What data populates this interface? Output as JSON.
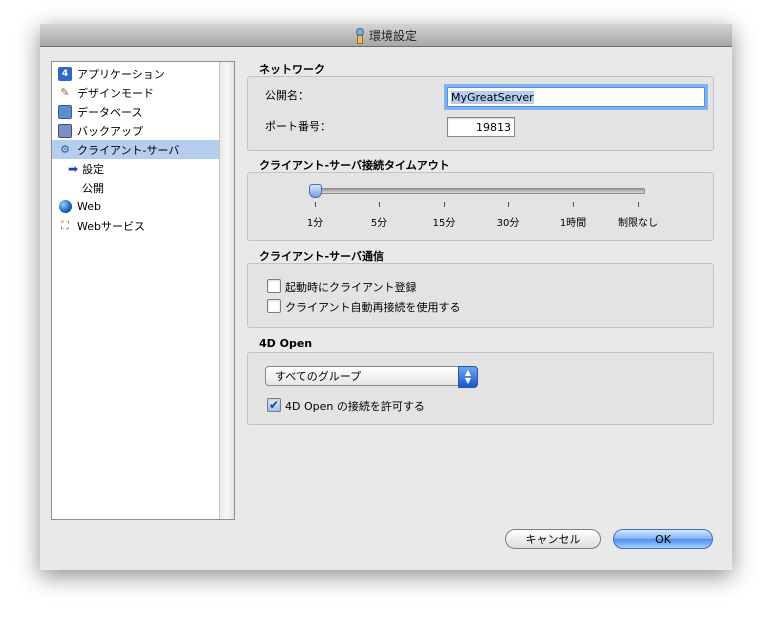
{
  "window": {
    "title": "環境設定"
  },
  "sidebar": {
    "items": [
      {
        "label": "アプリケーション",
        "icon": "application-icon"
      },
      {
        "label": "デザインモード",
        "icon": "design-mode-icon"
      },
      {
        "label": "データベース",
        "icon": "database-icon"
      },
      {
        "label": "バックアップ",
        "icon": "backup-icon"
      },
      {
        "label": "クライアント-サーバ",
        "icon": "client-server-icon",
        "selected": true
      },
      {
        "label": "設定",
        "sub": true,
        "current": true
      },
      {
        "label": "公開",
        "sub": true
      },
      {
        "label": "Web",
        "icon": "web-globe-icon"
      },
      {
        "label": "Webサービス",
        "icon": "web-services-icon"
      }
    ]
  },
  "network": {
    "title": "ネットワーク",
    "publish_name_label": "公開名：",
    "publish_name_value": "MyGreatServer",
    "port_label": "ポート番号：",
    "port_value": "19813"
  },
  "timeout": {
    "title": "クライアント-サーバ接続タイムアウト",
    "ticks": [
      "1分",
      "5分",
      "15分",
      "30分",
      "1時間",
      "制限なし"
    ],
    "selected": "1分"
  },
  "communication": {
    "title": "クライアント-サーバ通信",
    "options": [
      {
        "label": "起動時にクライアント登録",
        "checked": false
      },
      {
        "label": "クライアント自動再接続を使用する",
        "checked": false
      }
    ]
  },
  "open4d": {
    "title": "4D Open",
    "group_select": "すべてのグループ",
    "allow_label": "4D Open の接続を許可する",
    "allow_checked": true
  },
  "buttons": {
    "cancel": "キャンセル",
    "ok": "OK"
  },
  "colors": {
    "selection": "#b5cdee",
    "accent": "#4c8ef0"
  }
}
